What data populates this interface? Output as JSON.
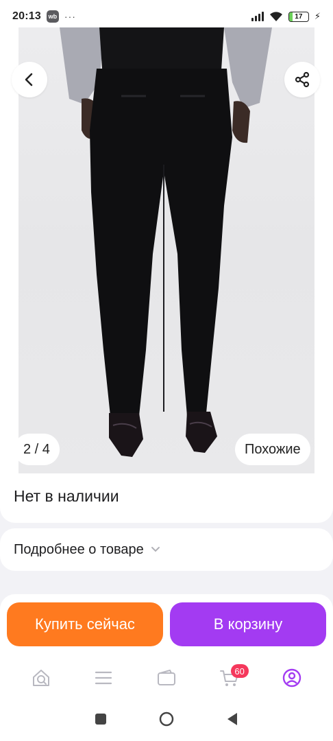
{
  "status_bar": {
    "time": "20:13",
    "app_badge": "wb",
    "dots": "···",
    "battery_level": "17"
  },
  "product": {
    "image_counter": "2 / 4",
    "similar_label": "Похожие",
    "stock_status": "Нет в наличии",
    "details_label": "Подробнее о товаре"
  },
  "actions": {
    "buy_now_label": "Купить сейчас",
    "add_to_cart_label": "В корзину"
  },
  "bottom_nav": {
    "cart_badge": "60",
    "items": [
      "home-icon",
      "catalog-icon",
      "wallet-icon",
      "cart-icon",
      "profile-icon"
    ]
  },
  "colors": {
    "buy_button": "#ff7a1f",
    "cart_button": "#a33bf2",
    "accent": "#a33bf2",
    "badge": "#f5385c"
  }
}
